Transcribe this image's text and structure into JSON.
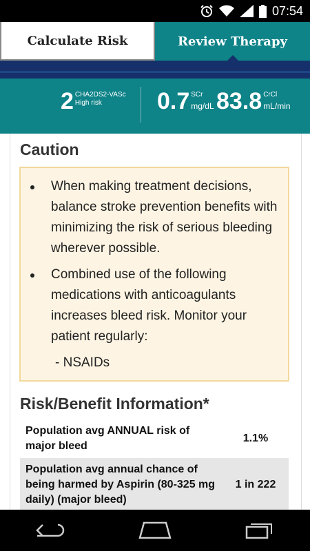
{
  "status_bar": {
    "time": "07:54",
    "icons": [
      "alarm-icon",
      "wifi-icon",
      "signal-icon",
      "battery-icon"
    ]
  },
  "tabs": {
    "calculate": "Calculate Risk",
    "review": "Review Therapy"
  },
  "stats": {
    "score": {
      "value": "2",
      "label": "CHA2DS2-VASc",
      "sublabel": "High risk"
    },
    "scr": {
      "value": "0.7",
      "sup": "SCr",
      "unit": "mg/dL"
    },
    "crcl": {
      "value": "83.8",
      "sup": "CrCl",
      "unit": "mL/min"
    }
  },
  "caution": {
    "title": "Caution",
    "bullets": [
      "When making treatment decisions, balance stroke prevention benefits with minimizing the risk of serious bleeding wherever possible.",
      "Combined use of the following medications with anticoagulants increases bleed risk. Monitor your patient regularly:"
    ],
    "sub_item": "- NSAIDs"
  },
  "risk_benefit": {
    "title": "Risk/Benefit Information*",
    "rows": [
      {
        "label": "Population avg ANNUAL risk of major bleed",
        "value": "1.1%"
      },
      {
        "label": "Population avg annual chance of being harmed by Aspirin (80-325 mg daily) (major bleed)",
        "value": "1 in 222"
      }
    ]
  },
  "colors": {
    "teal": "#0e8388",
    "navy": "#15306a",
    "caution_bg": "#fdf4e3",
    "caution_border": "#f2d89c"
  },
  "nav_bar": {
    "icons": [
      "back-icon",
      "home-icon",
      "recent-apps-icon"
    ]
  }
}
